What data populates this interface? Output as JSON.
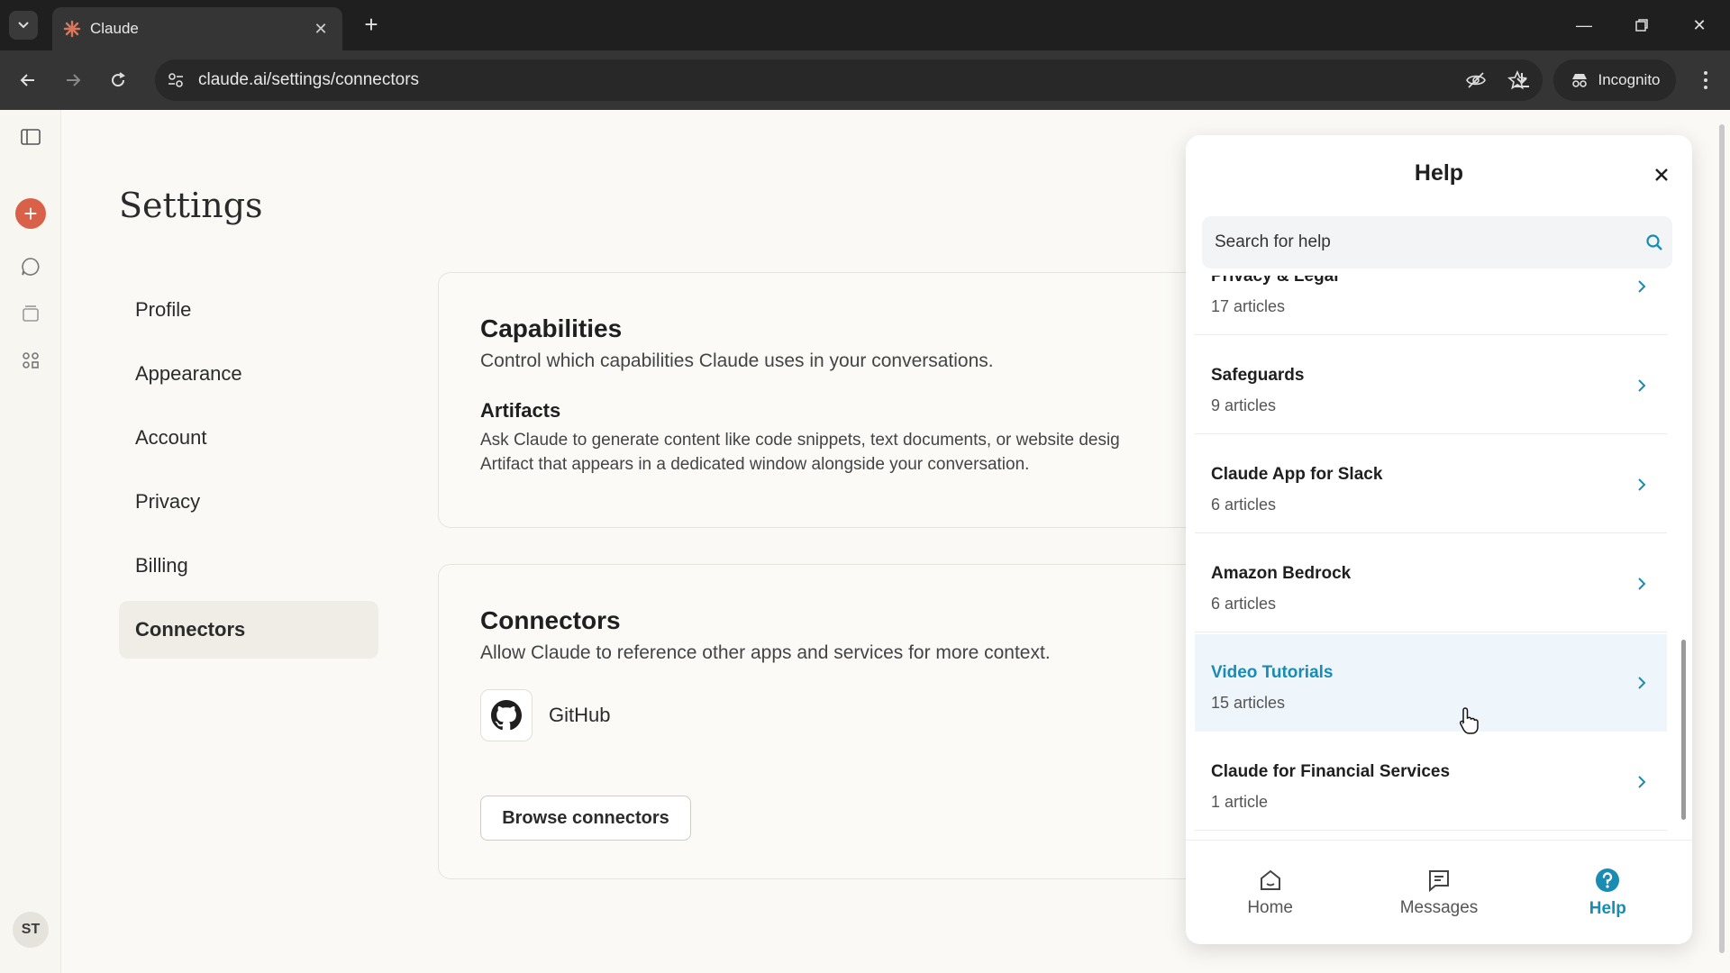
{
  "browser": {
    "tab_title": "Claude",
    "url": "claude.ai/settings/connectors",
    "incognito_label": "Incognito"
  },
  "sidebar_rail": {
    "avatar_initials": "ST"
  },
  "settings": {
    "title": "Settings",
    "nav": [
      {
        "label": "Profile"
      },
      {
        "label": "Appearance"
      },
      {
        "label": "Account"
      },
      {
        "label": "Privacy"
      },
      {
        "label": "Billing"
      },
      {
        "label": "Connectors",
        "active": true
      }
    ]
  },
  "capabilities": {
    "title": "Capabilities",
    "description": "Control which capabilities Claude uses in your conversations.",
    "artifacts_title": "Artifacts",
    "artifacts_desc_line1": "Ask Claude to generate content like code snippets, text documents, or website desig",
    "artifacts_desc_line2": "Artifact that appears in a dedicated window alongside your conversation."
  },
  "connectors": {
    "title": "Connectors",
    "description": "Allow Claude to reference other apps and services for more context.",
    "github_label": "GitHub",
    "browse_label": "Browse connectors"
  },
  "help": {
    "title": "Help",
    "search_placeholder": "Search for help",
    "collections": [
      {
        "title": "Privacy & Legal",
        "count": "17 articles"
      },
      {
        "title": "Safeguards",
        "count": "9 articles"
      },
      {
        "title": "Claude App for Slack",
        "count": "6 articles"
      },
      {
        "title": "Amazon Bedrock",
        "count": "6 articles"
      },
      {
        "title": "Video Tutorials",
        "count": "15 articles",
        "hover": true
      },
      {
        "title": "Claude for Financial Services",
        "count": "1 article"
      }
    ],
    "tabs": [
      {
        "label": "Home",
        "icon": "home-icon"
      },
      {
        "label": "Messages",
        "icon": "messages-icon"
      },
      {
        "label": "Help",
        "icon": "help-icon",
        "active": true
      }
    ]
  },
  "colors": {
    "accent": "#1a8bb3",
    "new_chat": "#d9614a"
  }
}
